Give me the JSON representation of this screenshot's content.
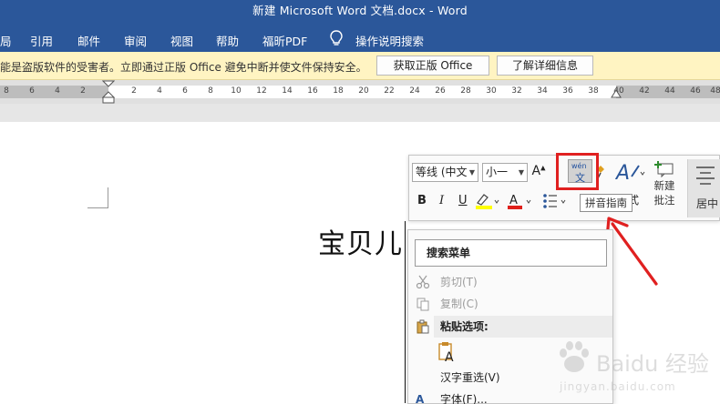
{
  "titlebar": {
    "title": "新建 Microsoft Word 文档.docx  -  Word"
  },
  "tabs": [
    "局",
    "引用",
    "邮件",
    "审阅",
    "视图",
    "帮助",
    "福昕PDF"
  ],
  "tell_me": "操作说明搜索",
  "message_bar": {
    "text": "能是盗版软件的受害者。立即通过正版 Office 避免中断并使文件保持安全。",
    "buttons": [
      "获取正版 Office",
      "了解详细信息"
    ]
  },
  "ruler": {
    "numbers": [
      "8",
      "6",
      "4",
      "2",
      "2",
      "4",
      "6",
      "8",
      "10",
      "12",
      "14",
      "16",
      "18",
      "20",
      "22",
      "24",
      "26",
      "28",
      "30",
      "32",
      "34",
      "36",
      "38",
      "40",
      "42",
      "44",
      "46",
      "48"
    ]
  },
  "document": {
    "text": "宝贝儿"
  },
  "mini_toolbar": {
    "font_name": "等线 (中文",
    "font_size": "小一",
    "grow_font": "A",
    "bold": "B",
    "italic": "I",
    "underline": "U",
    "new_comment_line1": "新建",
    "new_comment_line2": "批注",
    "center": "居中",
    "styles_partial": "式",
    "tooltip": "拼音指南",
    "phonetic_icon_top": "wén",
    "phonetic_icon_bottom": "文"
  },
  "context_menu": {
    "search": "搜索菜单",
    "cut": "剪切(T)",
    "copy": "复制(C)",
    "paste_options": "粘贴选项:",
    "reconvert": "汉字重选(V)",
    "font": "字体(F)..."
  },
  "watermark": {
    "line1": "Baidu 经验",
    "line2": "jingyan.baidu.com"
  },
  "colors": {
    "brand": "#2b579a",
    "message_bar": "#fff4c2",
    "annotation": "#e02020",
    "highlight_yellow": "#ffff00",
    "font_red": "#e0201a"
  },
  "icons": [
    "lightbulb-icon",
    "cut-icon",
    "copy-icon",
    "paste-icon",
    "paste-keep-text-icon",
    "font-icon",
    "phonetic-guide-icon",
    "format-painter-icon",
    "styles-icon",
    "new-comment-icon",
    "center-align-icon",
    "highlighter-icon",
    "font-color-icon",
    "bullets-icon"
  ]
}
